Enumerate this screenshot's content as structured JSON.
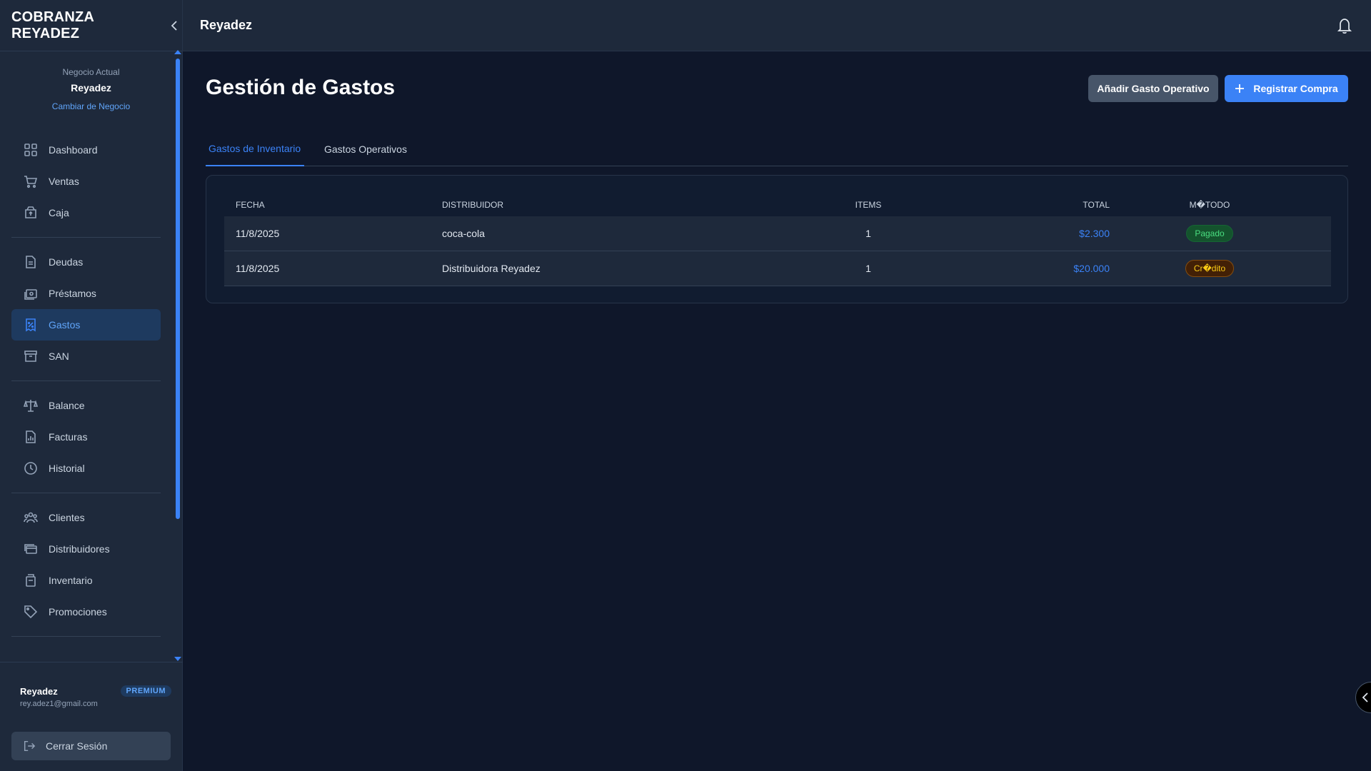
{
  "app": {
    "brand_title": "COBRANZA REYADEZ",
    "header_title": "Reyadez"
  },
  "business": {
    "caption": "Negocio Actual",
    "name": "Reyadez",
    "change_link": "Cambiar de Negocio"
  },
  "sidebar": {
    "items": [
      {
        "label": "Dashboard",
        "icon": "grid-icon"
      },
      {
        "label": "Ventas",
        "icon": "cart-icon"
      },
      {
        "label": "Caja",
        "icon": "cash-box-icon"
      },
      {
        "label": "Deudas",
        "icon": "document-icon"
      },
      {
        "label": "Préstamos",
        "icon": "money-icon"
      },
      {
        "label": "Gastos",
        "icon": "receipt-icon",
        "active": true
      },
      {
        "label": "SAN",
        "icon": "archive-icon"
      },
      {
        "label": "Balance",
        "icon": "scale-icon"
      },
      {
        "label": "Facturas",
        "icon": "report-icon"
      },
      {
        "label": "Historial",
        "icon": "clock-icon"
      },
      {
        "label": "Clientes",
        "icon": "users-icon"
      },
      {
        "label": "Distribuidores",
        "icon": "cards-icon"
      },
      {
        "label": "Inventario",
        "icon": "box-icon"
      },
      {
        "label": "Promociones",
        "icon": "tag-icon"
      }
    ]
  },
  "user": {
    "name": "Reyadez",
    "plan": "PREMIUM",
    "email": "rey.adez1@gmail.com",
    "logout_label": "Cerrar Sesión"
  },
  "page": {
    "title": "Gestión de Gastos",
    "add_operational_label": "Añadir Gasto Operativo",
    "register_purchase_label": "Registrar Compra"
  },
  "tabs": [
    {
      "label": "Gastos de Inventario",
      "active": true
    },
    {
      "label": "Gastos Operativos",
      "active": false
    }
  ],
  "table": {
    "headers": {
      "fecha": "FECHA",
      "distribuidor": "DISTRIBUIDOR",
      "items": "ITEMS",
      "total": "TOTAL",
      "metodo": "M�TODO"
    },
    "rows": [
      {
        "fecha": "11/8/2025",
        "distribuidor": "coca-cola",
        "items": "1",
        "total": "$2.300",
        "metodo": "Pagado",
        "metodo_status": "paid"
      },
      {
        "fecha": "11/8/2025",
        "distribuidor": "Distribuidora Reyadez",
        "items": "1",
        "total": "$20.000",
        "metodo": "Cr�dito",
        "metodo_status": "credit"
      }
    ]
  },
  "colors": {
    "accent": "#3b82f6",
    "background": "#0f172a",
    "sidebar": "#1e293b",
    "paid": "#4ade80",
    "credit": "#facc15"
  }
}
